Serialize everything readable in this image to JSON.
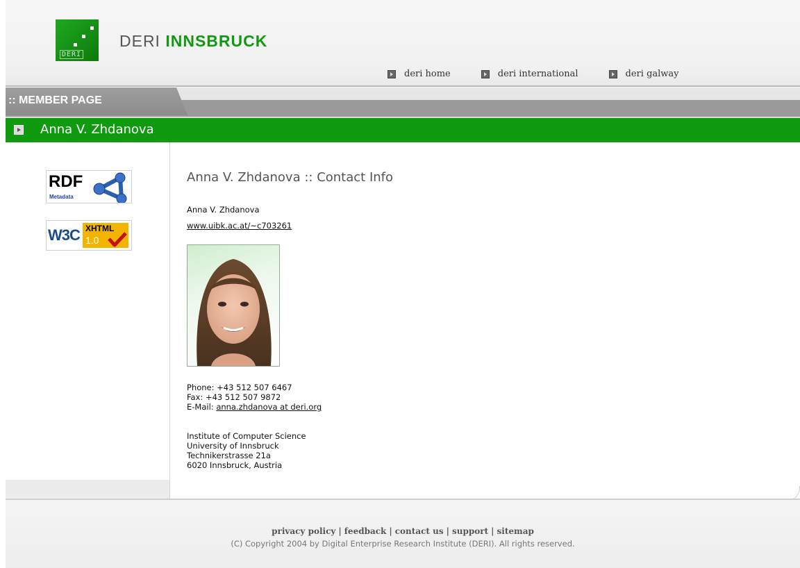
{
  "header": {
    "brand_part1": "DERI",
    "brand_part2": "INNSBRUCK",
    "logo_label": "DERI",
    "nav": [
      {
        "label": "deri home"
      },
      {
        "label": "deri international"
      },
      {
        "label": "deri galway"
      }
    ]
  },
  "member_bar": {
    "label": ":: MEMBER PAGE"
  },
  "title_bar": {
    "title": "Anna V. Zhdanova"
  },
  "sidebar": {
    "rdf_badge": {
      "text": "RDF",
      "sub": "Metadata"
    },
    "w3c_badge": {
      "text": "W3C",
      "kind": "XHTML",
      "version": "1.0"
    }
  },
  "content": {
    "heading": "Anna V. Zhdanova :: Contact Info",
    "name": "Anna V. Zhdanova",
    "url": "www.uibk.ac.at/~c703261",
    "phone": "Phone: +43 512 507 6467",
    "fax": "Fax: +43 512 507 9872",
    "email_label": "E-Mail:",
    "email": "anna.zhdanova at deri.org",
    "address": [
      "Institute of Computer Science",
      "University of Innsbruck",
      "Technikerstrasse 21a",
      "6020 Innsbruck, Austria"
    ]
  },
  "footer": {
    "links": [
      "privacy policy",
      "feedback",
      "contact us",
      "support",
      "sitemap"
    ],
    "separator": "|",
    "copyright": "(C) Copyright 2004 by Digital Enterprise Research Institute (DERI). All rights reserved."
  },
  "colors": {
    "accent_green": "#0f9a0f",
    "tab_grey": "#9a9a9a"
  }
}
